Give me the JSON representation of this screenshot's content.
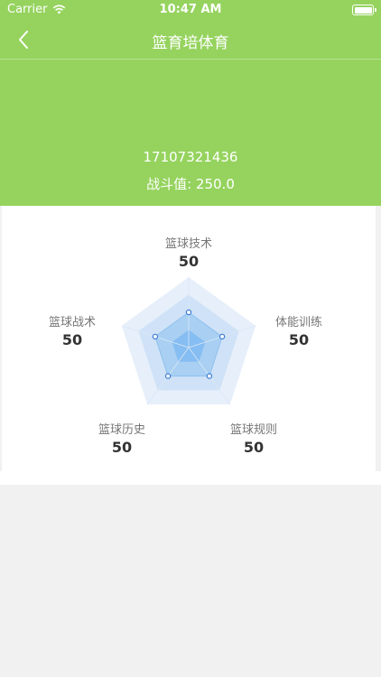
{
  "status_bar": {
    "carrier": "Carrier",
    "time": "10:47 AM"
  },
  "nav": {
    "title": "篮育培体育"
  },
  "profile": {
    "user_id": "17107321436",
    "combat_value": "战斗值: 250.0"
  },
  "radar": {
    "max": 100,
    "axes": [
      {
        "name": "篮球技术",
        "value": "50"
      },
      {
        "name": "体能训练",
        "value": "50"
      },
      {
        "name": "篮球规则",
        "value": "50"
      },
      {
        "name": "篮球历史",
        "value": "50"
      },
      {
        "name": "篮球战术",
        "value": "50"
      }
    ],
    "colors": {
      "ring_outer": "#e6effa",
      "ring_mid": "#cfe2f7",
      "ring_inner": "#a9d0f3",
      "core": "#86bdf2",
      "point": "#3a7bd5"
    }
  },
  "colors": {
    "header_green": "#95d35e",
    "page_bg": "#f1f1f1"
  }
}
